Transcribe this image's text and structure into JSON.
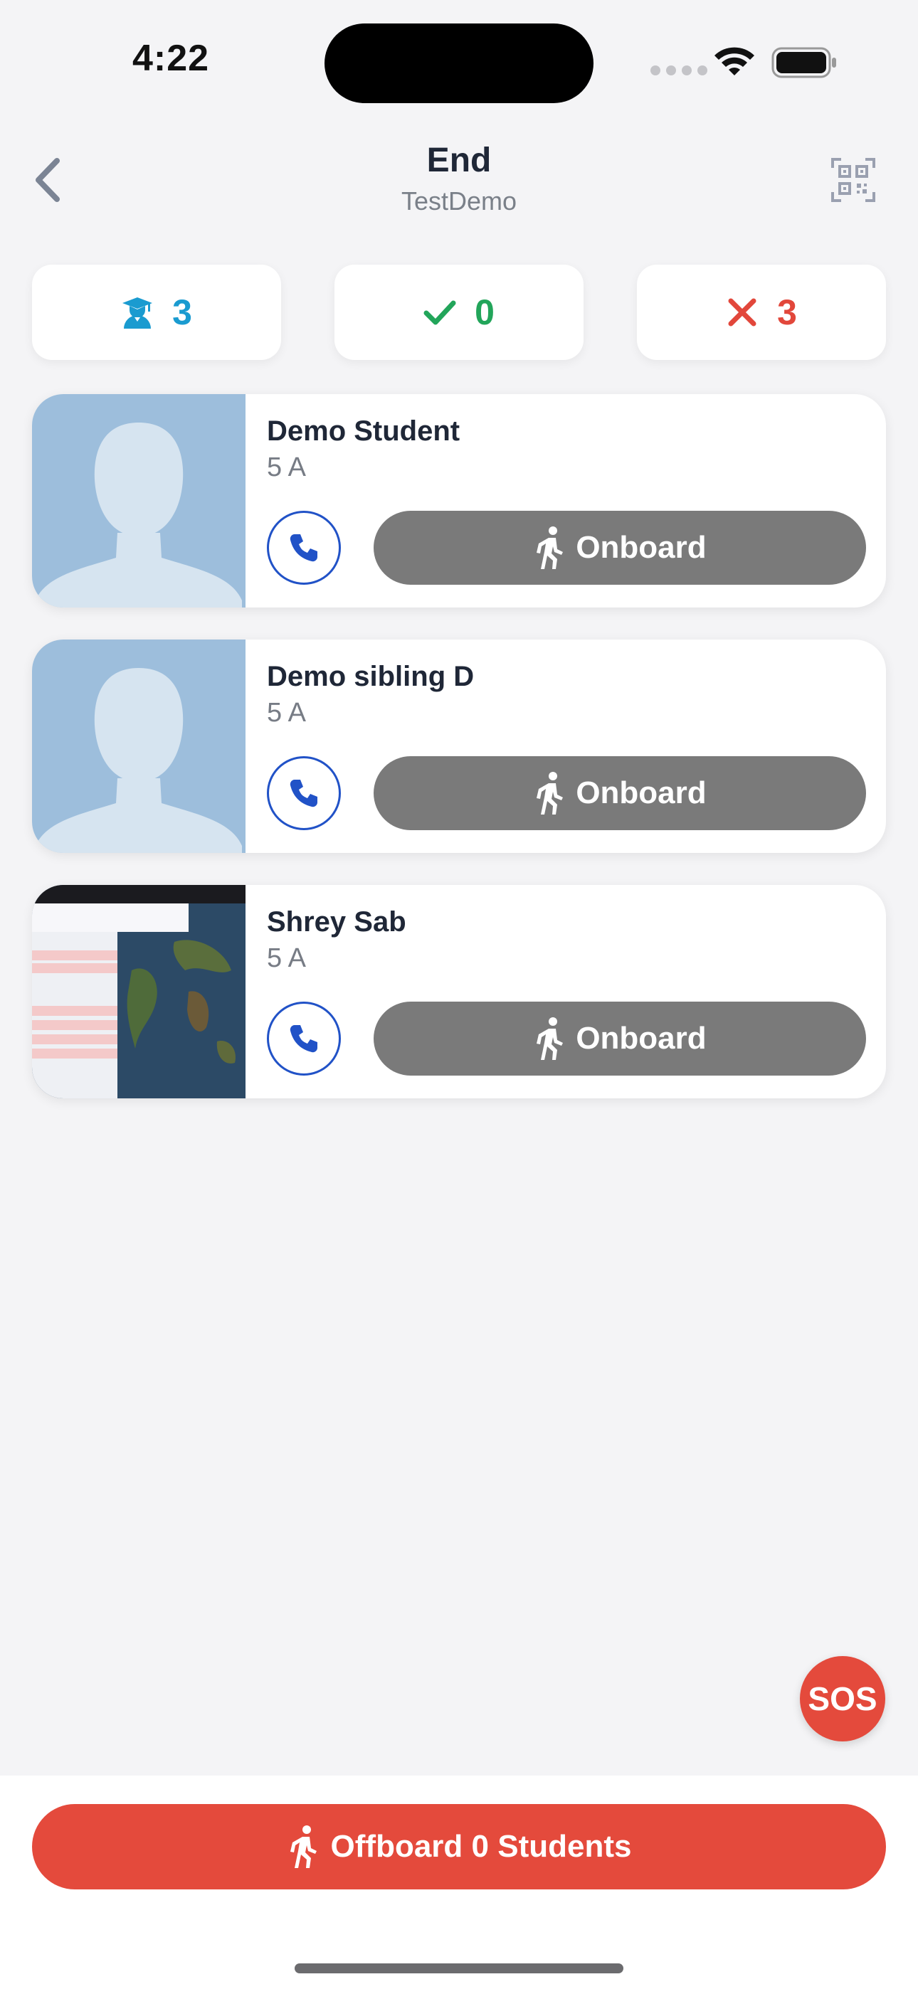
{
  "status_bar": {
    "time": "4:22"
  },
  "header": {
    "title": "End",
    "subtitle": "TestDemo"
  },
  "counters": {
    "total": "3",
    "onboarded": "0",
    "absent": "3"
  },
  "students": [
    {
      "name": "Demo Student",
      "class": "5 A",
      "action": "Onboard",
      "photo": "default-avatar"
    },
    {
      "name": "Demo sibling D",
      "class": "5 A",
      "action": "Onboard",
      "photo": "default-avatar"
    },
    {
      "name": "Shrey Sab",
      "class": "5 A",
      "action": "Onboard",
      "photo": "screenshot-thumbnail"
    }
  ],
  "sos": {
    "label": "SOS"
  },
  "footer": {
    "offboard_label": "Offboard 0 Students"
  },
  "colors": {
    "accent_red": "#e44a3c",
    "call_blue": "#2152c7",
    "total_blue": "#1a9bd0",
    "success_green": "#22a55a",
    "onboard_gray": "#7a7a7a"
  }
}
